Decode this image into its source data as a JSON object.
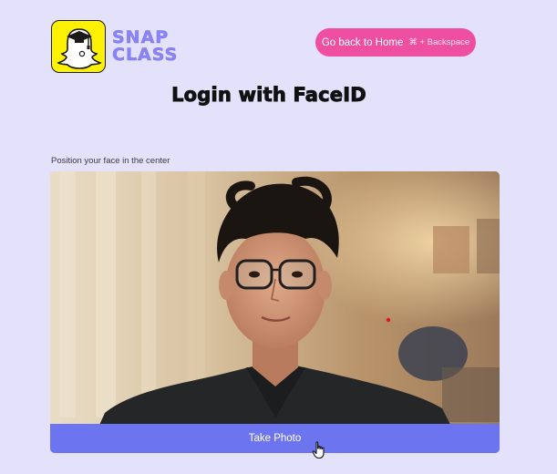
{
  "brand": {
    "line1": "SNAP",
    "line2": "CLASS",
    "icon": "graduate-ghost-icon",
    "logo_bg": "#fff200",
    "text_color": "#8b84f5"
  },
  "header": {
    "back_label": "Go back to Home",
    "back_shortcut": "⌘ + Backspace",
    "back_color": "#ee4fa1"
  },
  "main": {
    "title": "Login with FaceID",
    "hint": "Position your face in the center",
    "camera_icon": "webcam-feed",
    "take_photo_label": "Take Photo",
    "take_photo_color": "#6d74ef"
  },
  "pointer": {
    "icon": "hand-pointer-icon"
  }
}
